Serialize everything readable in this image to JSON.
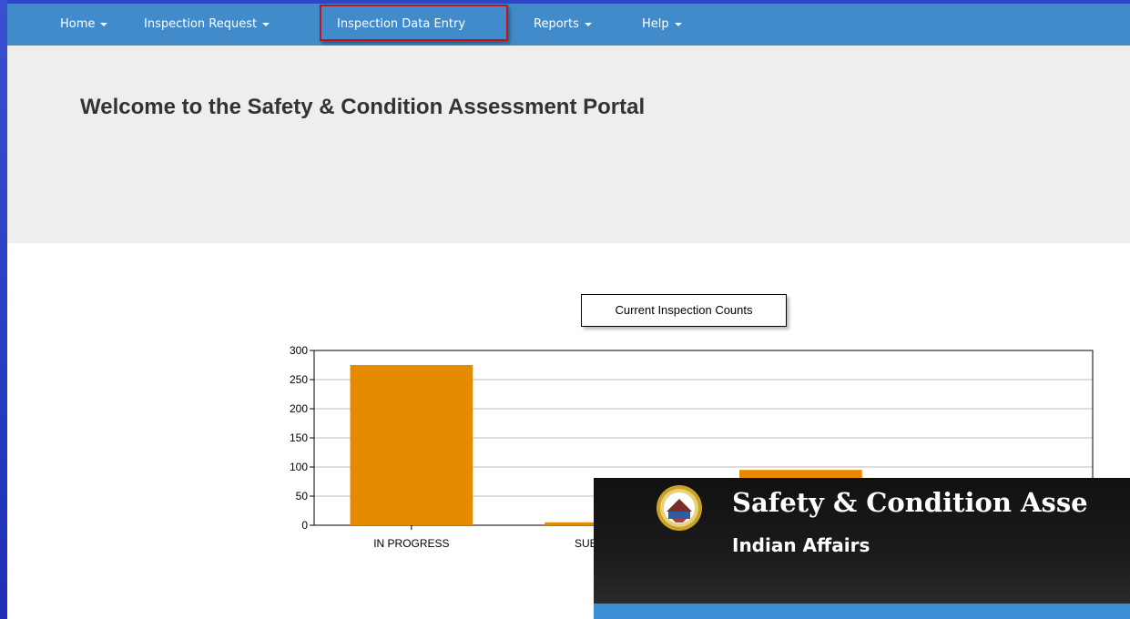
{
  "nav": {
    "items": [
      {
        "label": "Home",
        "caret": true
      },
      {
        "label": "Inspection Request",
        "caret": true
      },
      {
        "label": "Inspection Data Entry",
        "caret": false
      },
      {
        "label": "Reports",
        "caret": true
      },
      {
        "label": "Help",
        "caret": true
      }
    ],
    "background": "#428bca",
    "highlight_color": "#c0121f"
  },
  "jumbotron": {
    "welcome": "Welcome to the Safety & Condition Assessment Portal",
    "background": "#eeeeee"
  },
  "chart_data": {
    "type": "bar",
    "title": "Current Inspection Counts",
    "categories": [
      "IN PROGRESS",
      "SUBMITTED",
      "",
      ""
    ],
    "values": [
      275,
      5,
      95,
      0
    ],
    "ylim": [
      0,
      300
    ],
    "yticks": [
      0,
      50,
      100,
      150,
      200,
      250,
      300
    ],
    "grid": true,
    "bar_color": "#e68a00",
    "xlabel": "",
    "ylabel": ""
  },
  "overlay": {
    "title": "Safety & Condition Asse",
    "subtitle": "Indian Affairs",
    "seal_icon": "doi-seal-icon",
    "accent": "#3b8fd4"
  }
}
